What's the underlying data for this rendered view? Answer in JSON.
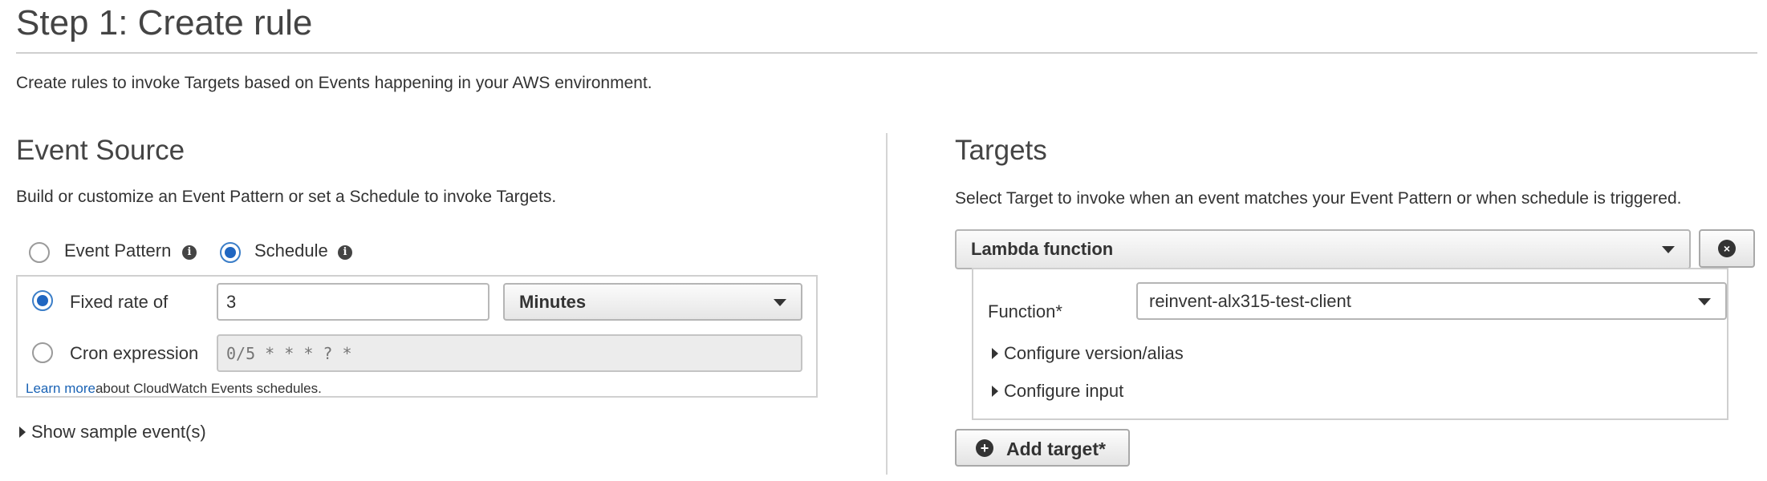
{
  "page": {
    "title": "Step 1: Create rule",
    "intro": "Create rules to invoke Targets based on Events happening in your AWS environment."
  },
  "event_source": {
    "title": "Event Source",
    "description": "Build or customize an Event Pattern or set a Schedule to invoke Targets.",
    "mode_options": [
      {
        "label": "Event Pattern",
        "checked": false
      },
      {
        "label": "Schedule",
        "checked": true
      }
    ],
    "fixed_rate": {
      "label": "Fixed rate of",
      "checked": true,
      "value": "3",
      "unit": "Minutes"
    },
    "cron": {
      "label": "Cron expression",
      "checked": false,
      "placeholder": "0/5 * * * ? *"
    },
    "learn_more": {
      "link": "Learn more",
      "text": "about CloudWatch Events schedules."
    },
    "show_sample": "Show sample event(s)"
  },
  "targets": {
    "title": "Targets",
    "description": "Select Target to invoke when an event matches your Event Pattern or when schedule is triggered.",
    "target_type": "Lambda function",
    "function_label": "Function*",
    "function_value": "reinvent-alx315-test-client",
    "configure_version": "Configure version/alias",
    "configure_input": "Configure input",
    "add_target": "Add target*"
  },
  "colors": {
    "accent": "#1f66c1",
    "link": "#1a63b5",
    "border": "#d0d0d0"
  },
  "icons": {
    "info": "info-icon",
    "dropdown": "chevron-down-icon",
    "remove": "close-icon",
    "add": "plus-icon",
    "expand": "caret-right-icon"
  }
}
